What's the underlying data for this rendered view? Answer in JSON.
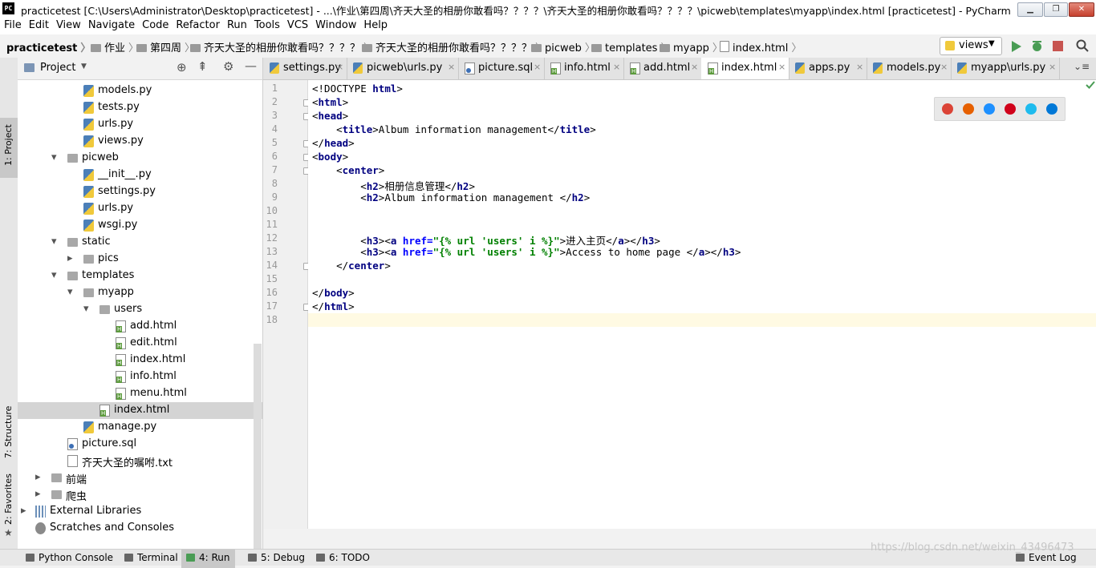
{
  "window": {
    "title": "practicetest [C:\\Users\\Administrator\\Desktop\\practicetest] - ...\\作业\\第四周\\齐天大圣的相册你敢看吗？？？？\\齐天大圣的相册你敢看吗？？？？\\picweb\\templates\\myapp\\index.html [practicetest] - PyCharm (Administr...",
    "app_icon": "PC",
    "minimize_label": "▁",
    "maximize_label": "❐",
    "close_label": "✕"
  },
  "menu": [
    "File",
    "Edit",
    "View",
    "Navigate",
    "Code",
    "Refactor",
    "Run",
    "Tools",
    "VCS",
    "Window",
    "Help"
  ],
  "breadcrumbs": [
    "practicetest",
    "作业",
    "第四周",
    "齐天大圣的相册你敢看吗？？？？",
    "齐天大圣的相册你敢看吗？？？？",
    "picweb",
    "templates",
    "myapp",
    "index.html"
  ],
  "run_config": "views",
  "project_panel": {
    "title": "Project",
    "tree": [
      {
        "label": "models.py",
        "icon": "python-file-icon",
        "indent": 2,
        "arrow": ""
      },
      {
        "label": "tests.py",
        "icon": "python-file-icon",
        "indent": 2,
        "arrow": ""
      },
      {
        "label": "urls.py",
        "icon": "python-file-icon",
        "indent": 2,
        "arrow": ""
      },
      {
        "label": "views.py",
        "icon": "python-file-icon",
        "indent": 2,
        "arrow": ""
      },
      {
        "label": "picweb",
        "icon": "folder-icon",
        "indent": 1,
        "arrow": "⌄"
      },
      {
        "label": "__init__.py",
        "icon": "python-file-icon",
        "indent": 2,
        "arrow": ""
      },
      {
        "label": "settings.py",
        "icon": "python-file-icon",
        "indent": 2,
        "arrow": ""
      },
      {
        "label": "urls.py",
        "icon": "python-file-icon",
        "indent": 2,
        "arrow": ""
      },
      {
        "label": "wsgi.py",
        "icon": "python-file-icon",
        "indent": 2,
        "arrow": ""
      },
      {
        "label": "static",
        "icon": "folder-icon",
        "indent": 1,
        "arrow": "⌄"
      },
      {
        "label": "pics",
        "icon": "folder-icon",
        "indent": 2,
        "arrow": "›"
      },
      {
        "label": "templates",
        "icon": "folder-icon",
        "indent": 1,
        "arrow": "⌄"
      },
      {
        "label": "myapp",
        "icon": "folder-icon",
        "indent": 2,
        "arrow": "⌄"
      },
      {
        "label": "users",
        "icon": "folder-icon",
        "indent": 3,
        "arrow": "⌄"
      },
      {
        "label": "add.html",
        "icon": "html-file-icon",
        "indent": 4,
        "arrow": ""
      },
      {
        "label": "edit.html",
        "icon": "html-file-icon",
        "indent": 4,
        "arrow": ""
      },
      {
        "label": "index.html",
        "icon": "html-file-icon",
        "indent": 4,
        "arrow": ""
      },
      {
        "label": "info.html",
        "icon": "html-file-icon",
        "indent": 4,
        "arrow": ""
      },
      {
        "label": "menu.html",
        "icon": "html-file-icon",
        "indent": 4,
        "arrow": ""
      },
      {
        "label": "index.html",
        "icon": "html-file-icon",
        "indent": 3,
        "arrow": "",
        "selected": true
      },
      {
        "label": "manage.py",
        "icon": "python-file-icon",
        "indent": 2,
        "arrow": ""
      },
      {
        "label": "picture.sql",
        "icon": "sql-file-icon",
        "indent": 1,
        "arrow": ""
      },
      {
        "label": "齐天大圣的嘱咐.txt",
        "icon": "text-file-icon",
        "indent": 1,
        "arrow": ""
      },
      {
        "label": "前端",
        "icon": "folder-icon",
        "indent": 0,
        "arrow": "›"
      },
      {
        "label": "爬虫",
        "icon": "folder-icon",
        "indent": 0,
        "arrow": "›"
      },
      {
        "label": "External Libraries",
        "icon": "library-icon",
        "indent": -1,
        "arrow": "›"
      },
      {
        "label": "Scratches and Consoles",
        "icon": "scratches-icon",
        "indent": -1,
        "arrow": ""
      }
    ]
  },
  "side_tabs": {
    "project": "1: Project",
    "structure": "7: Structure",
    "favorites": "2: Favorites"
  },
  "editor_tabs": [
    {
      "label": "settings.py",
      "icon": "python-file-icon"
    },
    {
      "label": "picweb\\urls.py",
      "icon": "python-file-icon"
    },
    {
      "label": "picture.sql",
      "icon": "sql-file-icon"
    },
    {
      "label": "info.html",
      "icon": "html-file-icon"
    },
    {
      "label": "add.html",
      "icon": "html-file-icon"
    },
    {
      "label": "index.html",
      "icon": "html-file-icon",
      "active": true
    },
    {
      "label": "apps.py",
      "icon": "python-file-icon"
    },
    {
      "label": "models.py",
      "icon": "python-file-icon"
    },
    {
      "label": "myapp\\urls.py",
      "icon": "python-file-icon"
    }
  ],
  "editor": {
    "lines": [
      [
        [
          "doc",
          "<!DOCTYPE "
        ],
        [
          "tg",
          "html"
        ],
        [
          "doc",
          ">"
        ]
      ],
      [
        [
          "doc",
          "<"
        ],
        [
          "tg",
          "html"
        ],
        [
          "doc",
          ">"
        ]
      ],
      [
        [
          "doc",
          "<"
        ],
        [
          "tg",
          "head"
        ],
        [
          "doc",
          ">"
        ]
      ],
      [
        [
          "doc",
          "    <"
        ],
        [
          "tg",
          "title"
        ],
        [
          "doc",
          ">Album information management</"
        ],
        [
          "tg",
          "title"
        ],
        [
          "doc",
          ">"
        ]
      ],
      [
        [
          "doc",
          "</"
        ],
        [
          "tg",
          "head"
        ],
        [
          "doc",
          ">"
        ]
      ],
      [
        [
          "doc",
          "<"
        ],
        [
          "tg",
          "body"
        ],
        [
          "doc",
          ">"
        ]
      ],
      [
        [
          "doc",
          "    <"
        ],
        [
          "tg",
          "center"
        ],
        [
          "doc",
          ">"
        ]
      ],
      [
        [
          "doc",
          "        <"
        ],
        [
          "tg",
          "h2"
        ],
        [
          "doc",
          ">相册信息管理</"
        ],
        [
          "tg",
          "h2"
        ],
        [
          "doc",
          ">"
        ]
      ],
      [
        [
          "doc",
          "        <"
        ],
        [
          "tg",
          "h2"
        ],
        [
          "doc",
          ">Album information management </"
        ],
        [
          "tg",
          "h2"
        ],
        [
          "doc",
          ">"
        ]
      ],
      [],
      [],
      [
        [
          "doc",
          "        <"
        ],
        [
          "tg",
          "h3"
        ],
        [
          "doc",
          "><"
        ],
        [
          "tg",
          "a "
        ],
        [
          "at",
          "href="
        ],
        [
          "st",
          "\"{% url 'users' i %}\""
        ],
        [
          "doc",
          ">进入主页</"
        ],
        [
          "tg",
          "a"
        ],
        [
          "doc",
          "></"
        ],
        [
          "tg",
          "h3"
        ],
        [
          "doc",
          ">"
        ]
      ],
      [
        [
          "doc",
          "        <"
        ],
        [
          "tg",
          "h3"
        ],
        [
          "doc",
          "><"
        ],
        [
          "tg",
          "a "
        ],
        [
          "at",
          "href="
        ],
        [
          "st",
          "\"{% url 'users' i %}\""
        ],
        [
          "doc",
          ">Access to home page </"
        ],
        [
          "tg",
          "a"
        ],
        [
          "doc",
          "></"
        ],
        [
          "tg",
          "h3"
        ],
        [
          "doc",
          ">"
        ]
      ],
      [
        [
          "doc",
          "    </"
        ],
        [
          "tg",
          "center"
        ],
        [
          "doc",
          ">"
        ]
      ],
      [],
      [
        [
          "doc",
          "</"
        ],
        [
          "tg",
          "body"
        ],
        [
          "doc",
          ">"
        ]
      ],
      [
        [
          "doc",
          "</"
        ],
        [
          "tg",
          "html"
        ],
        [
          "doc",
          ">"
        ]
      ],
      []
    ],
    "current_line": 18,
    "fold_lines": [
      2,
      3,
      5,
      6,
      7,
      14,
      17
    ]
  },
  "browser_icons": [
    "chrome-icon",
    "firefox-icon",
    "safari-icon",
    "opera-icon",
    "ie-icon",
    "edge-icon"
  ],
  "bottom_tools": [
    {
      "label": "Python Console",
      "icon": "python-console-icon"
    },
    {
      "label": "Terminal",
      "icon": "terminal-icon"
    },
    {
      "label": "4: Run",
      "icon": "run-icon",
      "active": true
    },
    {
      "label": "5: Debug",
      "icon": "debug-icon"
    },
    {
      "label": "6: TODO",
      "icon": "todo-icon"
    },
    {
      "label": "Event Log",
      "icon": "event-log-icon"
    }
  ],
  "watermark": "https://blog.csdn.net/weixin_43496473"
}
